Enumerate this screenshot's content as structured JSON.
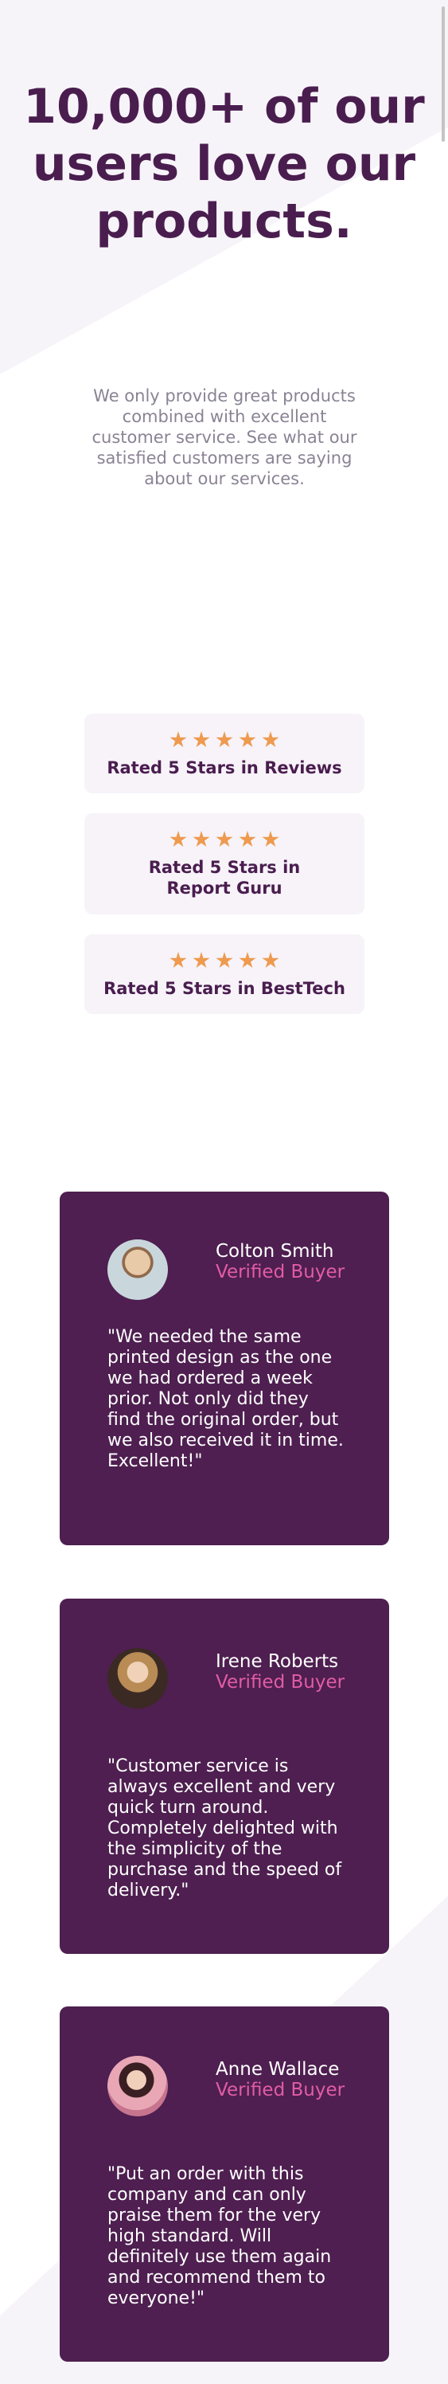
{
  "hero": {
    "title": "10,000+ of our users love our products.",
    "subtitle": "We only provide great products combined with excellent customer service. See what our satisfied customers are saying about our services."
  },
  "ratings": [
    {
      "stars": 5,
      "label": "Rated 5 Stars in Reviews"
    },
    {
      "stars": 5,
      "label": "Rated 5 Stars in Report Guru"
    },
    {
      "stars": 5,
      "label": "Rated 5 Stars in BestTech"
    }
  ],
  "testimonials": [
    {
      "name": "Colton Smith",
      "status": "Verified Buyer",
      "quote": "\"We needed the same printed design as the one we had ordered a week prior. Not only did they find the original order, but we also received it in time. Excellent!\""
    },
    {
      "name": "Irene Roberts",
      "status": "Verified Buyer",
      "quote": "\"Customer service is always excellent and very quick turn around. Completely delighted with the simplicity of the purchase and the speed of delivery.\""
    },
    {
      "name": "Anne Wallace",
      "status": "Verified Buyer",
      "quote": "\"Put an order with this company and can only praise them for the very high standard. Will definitely use them again and recommend them to everyone!\""
    }
  ],
  "colors": {
    "primary": "#4a1d4f",
    "accent_pink": "#e15ca5",
    "star": "#ee9a4f",
    "card_bg": "#f7f3f9",
    "muted_text": "#8a8394"
  }
}
